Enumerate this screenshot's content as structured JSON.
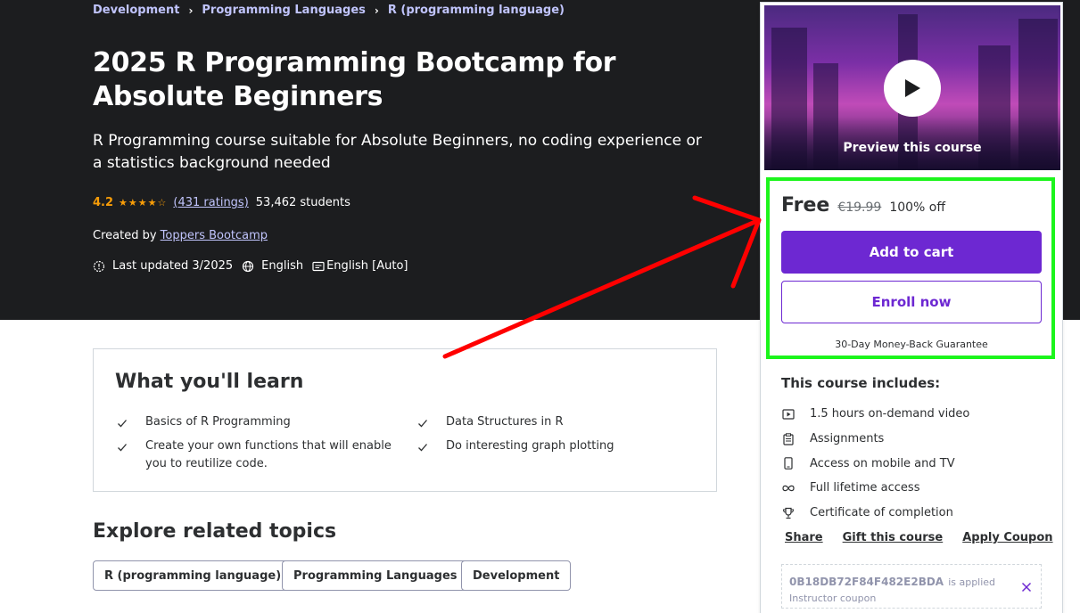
{
  "breadcrumb": [
    "Development",
    "Programming Languages",
    "R (programming language)"
  ],
  "course": {
    "title": "2025 R Programming Bootcamp for Absolute Beginners",
    "subtitle": "R Programming course suitable for Absolute Beginners, no coding experience or a statistics background needed",
    "rating": "4.2",
    "rating_stars": 4.2,
    "ratings_count": "(431 ratings)",
    "students": "53,462 students",
    "created_by_label": "Created by",
    "author": "Toppers Bootcamp",
    "last_updated": "Last updated 3/2025",
    "language": "English",
    "captions": "English [Auto]"
  },
  "sidebar": {
    "preview_label": "Preview this course",
    "price": "Free",
    "original_price": "€19.99",
    "discount": "100% off",
    "add_to_cart": "Add to cart",
    "enroll_now": "Enroll now",
    "guarantee": "30-Day Money-Back Guarantee",
    "includes_title": "This course includes:",
    "includes": [
      {
        "icon": "video-icon",
        "label": "1.5 hours on-demand video"
      },
      {
        "icon": "assignment-icon",
        "label": "Assignments"
      },
      {
        "icon": "mobile-icon",
        "label": "Access on mobile and TV"
      },
      {
        "icon": "infinity-icon",
        "label": "Full lifetime access"
      },
      {
        "icon": "trophy-icon",
        "label": "Certificate of completion"
      }
    ],
    "actions": [
      "Share",
      "Gift this course",
      "Apply Coupon"
    ],
    "coupon": {
      "code": "0B18DB72F84F482E2BDA",
      "applied_text": "is applied",
      "type": "Instructor coupon"
    }
  },
  "learn": {
    "title": "What you'll learn",
    "items": [
      "Basics of R Programming",
      "Data Structures in R",
      "Create your own functions that will enable you to reutilize code.",
      "Do interesting graph plotting"
    ]
  },
  "related": {
    "title": "Explore related topics",
    "tags": [
      "R (programming language)",
      "Programming Languages",
      "Development"
    ]
  },
  "colors": {
    "hero_bg": "#1c1d1f",
    "accent_purple": "#6d28d2",
    "link_lavender": "#c0c4fc",
    "star_orange": "#f69c08",
    "highlight_green": "#1cf51c",
    "annotation_red": "#ff0000"
  }
}
